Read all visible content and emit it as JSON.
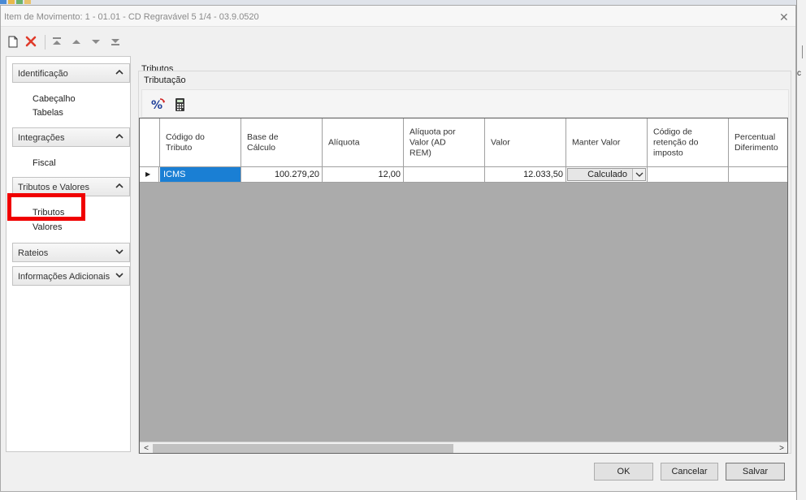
{
  "window": {
    "title": "Item de Movimento: 1 - 01.01 - CD Regravável 5 1/4 - 03.9.0520",
    "close_glyph": "✕"
  },
  "outer_fragment": {
    "text": "c"
  },
  "toolbar": {
    "items": [
      {
        "name": "new-icon"
      },
      {
        "name": "delete-icon",
        "color": "#e03a2a"
      },
      {
        "name": "move-first-icon"
      },
      {
        "name": "move-up-icon"
      },
      {
        "name": "move-down-icon"
      },
      {
        "name": "move-last-icon"
      }
    ]
  },
  "sidebar": {
    "groups": [
      {
        "label": "Identificação",
        "state": "expanded",
        "items": [
          "Cabeçalho",
          "Tabelas"
        ]
      },
      {
        "label": "Integrações",
        "state": "expanded",
        "items": [
          "Fiscal"
        ]
      },
      {
        "label": "Tributos e Valores",
        "state": "expanded",
        "items": [
          "Tributos",
          "Valores"
        ]
      },
      {
        "label": "Rateios",
        "state": "collapsed",
        "items": []
      },
      {
        "label": "Informações Adicionais",
        "state": "collapsed",
        "items": []
      }
    ],
    "highlight_color": "#f00000"
  },
  "content": {
    "section_title": "Tributos",
    "fieldset_title": "Tributação",
    "grid_toolbar": [
      {
        "name": "percent-icon"
      },
      {
        "name": "calculator-icon"
      }
    ],
    "columns": [
      "Código do\nTributo",
      "Base de\nCálculo",
      "Alíquota",
      "Alíquota por\nValor (AD\nREM)",
      "Valor",
      "Manter Valor",
      "Código de\nretenção do\nimposto",
      "Percentual\nDiferimento"
    ],
    "rows": [
      {
        "indicator": "▶",
        "codigo": "ICMS",
        "base": "100.279,20",
        "aliquota": "12,00",
        "aliquota_ad_rem": "",
        "valor": "12.033,50",
        "manter_valor": "Calculado",
        "codigo_retencao": "",
        "percentual_diferimento": ""
      }
    ],
    "scroll": {
      "left_glyph": "<",
      "right_glyph": ">"
    }
  },
  "buttons": {
    "ok": "OK",
    "cancel": "Cancelar",
    "save": "Salvar"
  },
  "colors": {
    "selection": "#1a7fd4",
    "grid_empty": "#ababab"
  }
}
